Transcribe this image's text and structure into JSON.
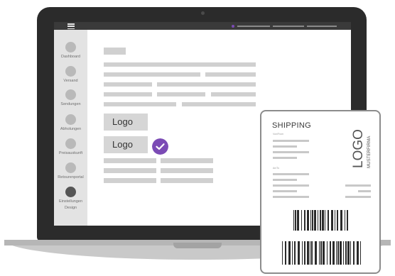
{
  "colors": {
    "accent": "#7b4bb5",
    "frame": "#2b2b2b",
    "sidebar": "#e3e3e3",
    "placeholder": "#d0d0d0"
  },
  "sidebar": {
    "items": [
      {
        "label": "Dashboard",
        "active": false
      },
      {
        "label": "Versand",
        "active": false
      },
      {
        "label": "Sendungen",
        "active": false
      },
      {
        "label": "Abholungen",
        "active": false
      },
      {
        "label": "Preisauskunft",
        "active": false
      },
      {
        "label": "Retourenportal",
        "active": false
      },
      {
        "label": "Einstellungen",
        "label2": "Design",
        "active": true
      }
    ]
  },
  "header": {
    "menu_icon": "hamburger-icon"
  },
  "main": {
    "logo_option_1": "Logo",
    "logo_option_2": "Logo",
    "selected_icon": "checkmark-icon"
  },
  "shipping_label": {
    "title": "SHIPPING",
    "from_caption": "Von/From",
    "to_caption": "An/To",
    "logo_text": "LOGO",
    "logo_subtext": "MUSTERFIRMA"
  }
}
